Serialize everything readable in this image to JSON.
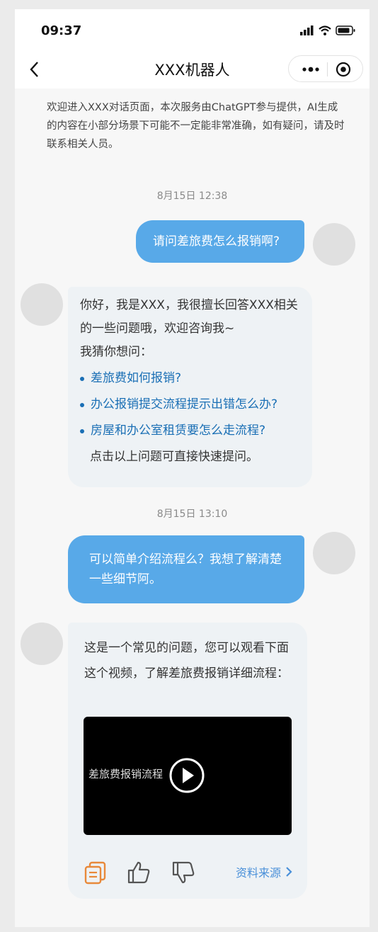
{
  "status_bar": {
    "time": "09:37",
    "icons": [
      "signal-icon",
      "wifi-icon",
      "battery-icon"
    ]
  },
  "nav": {
    "title": "XXX机器人",
    "icons": [
      "back-icon",
      "more-icon",
      "target-icon"
    ]
  },
  "notice": "欢迎进入XXX对话页面，本次服务由ChatGPT参与提供，AI生成的内容在小部分场景下可能不一定能非常准确，如有疑问，请及时联系相关人员。",
  "timestamps": [
    "8月15日 12:38",
    "8月15日 13:10"
  ],
  "messages": {
    "user1": "请问差旅费怎么报销啊?",
    "bot1_intro": "你好，我是XXX，我很擅长回答XXX相关的一些问题哦，欢迎咨询我~",
    "bot1_guess": "我猜你想问：",
    "bot1_suggestions": [
      "差旅费如何报销?",
      "办公报销提交流程提示出错怎么办?",
      "房屋和办公室租赁要怎么走流程?"
    ],
    "bot1_footer": "点击以上问题可直接快速提问。",
    "user2": "可以简单介绍流程么？我想了解清楚一些细节阿。",
    "bot2_text": "这是一个常见的问题，您可以观看下面这个视频，了解差旅费报销详细流程：",
    "video_title": "差旅费报销流程",
    "source_link": "资料来源"
  },
  "colors": {
    "accent_blue": "#58a9e8",
    "link_blue": "#1a6fb5",
    "copy_orange": "#e8893a",
    "bubble_bg": "#eef2f5"
  }
}
